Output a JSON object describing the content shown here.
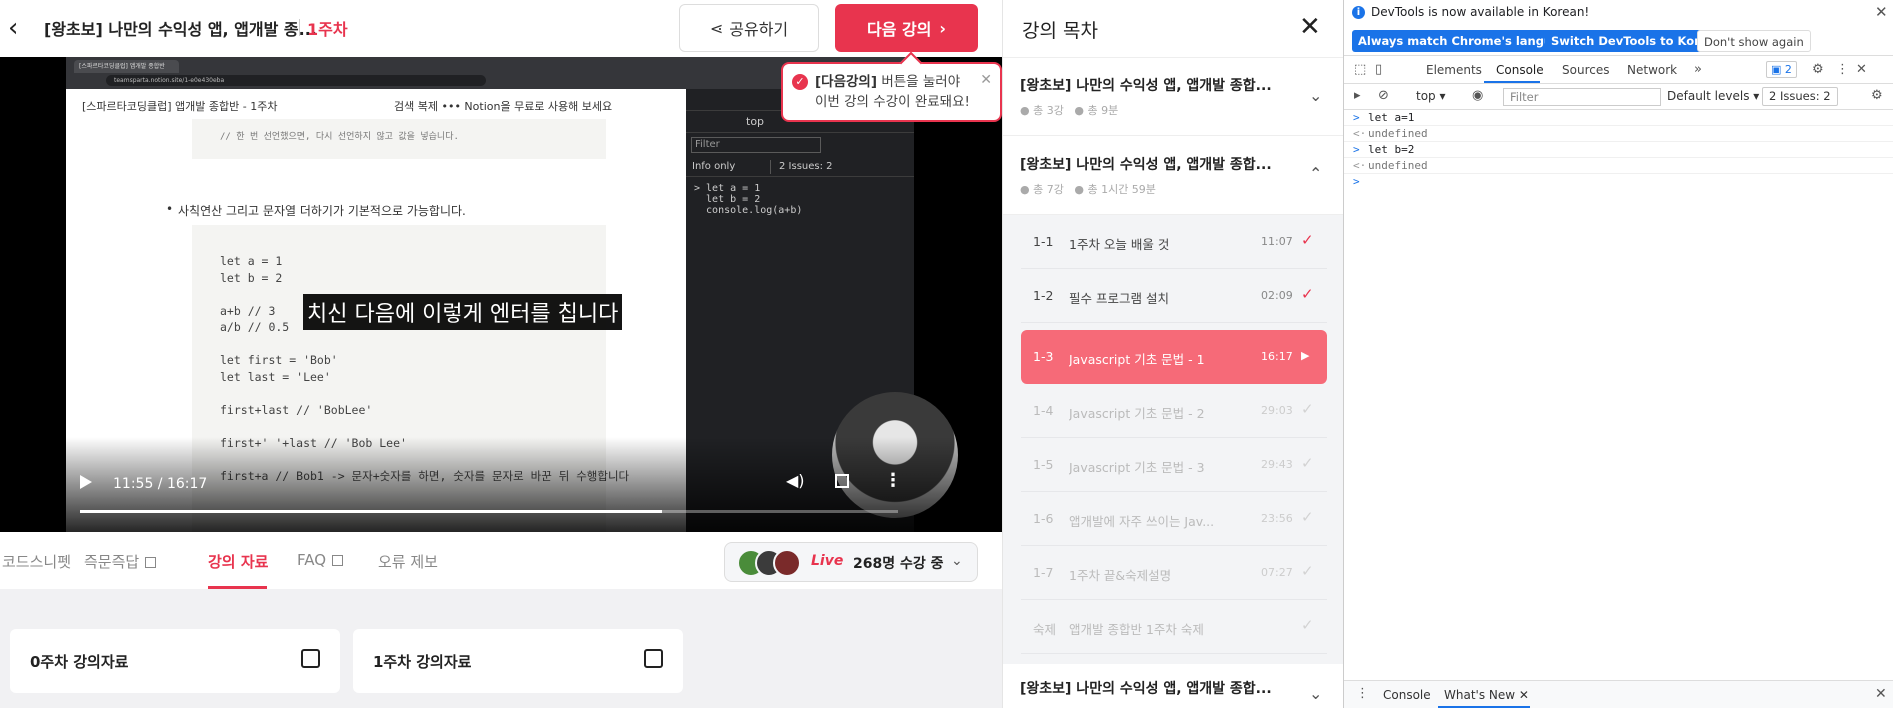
{
  "header": {
    "course_title": "[왕초보] 나만의 수익성 앱, 앱개발 종...",
    "week": "1주차",
    "share_label": "공유하기",
    "next_label": "다음 강의"
  },
  "tooltip": {
    "bold": "[다음강의]",
    "line1": " 버튼을 눌러야",
    "line2": "이번 강의 수강이 완료돼요!"
  },
  "video": {
    "browser_tab": "[스파르타코딩클럽] 앱개발 종합반",
    "url": "teamsparta.notion.site/1-e0e430eba",
    "notion_title": "[스파르타코딩클럽] 앱개발 종합반 - 1주차",
    "notion_right": "검색   복제   •••    Notion을 무료로 사용해 보세요",
    "code_top": "// 한 번 선언했으면, 다시 선언하지 않고 값을 넣습니다.",
    "bullet": "사칙연산 그리고 문자열 더하기가 기본적으로 가능합니다.",
    "code_main": "let a = 1\nlet b = 2\n\na+b // 3\na/b // 0.5\n\nlet first = 'Bob'\nlet last = 'Lee'\n\nfirst+last // 'BobLee'\n\nfirst+' '+last // 'Bob Lee'\n\nfirst+a // Bob1 -> 문자+숫자를 하면, 숫자를 문자로 바꾼 뒤 수행합니다",
    "dm_top": "top",
    "dm_filter": "Filter",
    "dm_info": "Info only",
    "dm_issues": "2 Issues: 2",
    "dm_code": "> let a = 1\n  let b = 2\n  console.log(a+b)",
    "subtitle": "치신 다음에 이렇게 엔터를 칩니다",
    "time": "11:55 / 16:17",
    "progress": 0.712
  },
  "tabs": [
    {
      "label": "코드스니펫"
    },
    {
      "label": "즉문즉답"
    },
    {
      "label": "강의 자료"
    },
    {
      "label": "FAQ"
    },
    {
      "label": "오류 제보"
    }
  ],
  "live": {
    "label": "Live",
    "viewers": "268명 수강 중"
  },
  "cards": [
    {
      "label": "0주차 강의자료"
    },
    {
      "label": "1주차 강의자료"
    }
  ],
  "outline": {
    "title": "강의 목차",
    "sections": [
      {
        "title": "[왕초보] 나만의 수익성 앱, 앱개발 종합...",
        "count": "총 3강",
        "duration": "총 9분"
      },
      {
        "title": "[왕초보] 나만의 수익성 앱, 앱개발 종합...",
        "count": "총 7강",
        "duration": "총 1시간 59분"
      },
      {
        "title": "[왕초보] 나만의 수익성 앱, 앱개발 종합..."
      }
    ],
    "lessons": [
      {
        "num": "1-1",
        "title": "1주차 오늘 배울 것",
        "duration": "11:07"
      },
      {
        "num": "1-2",
        "title": "필수 프로그램 설치",
        "duration": "02:09"
      },
      {
        "num": "1-3",
        "title": "Javascript 기초 문법 - 1",
        "duration": "16:17"
      },
      {
        "num": "1-4",
        "title": "Javascript 기초 문법 - 2",
        "duration": "29:03"
      },
      {
        "num": "1-5",
        "title": "Javascript 기초 문법 - 3",
        "duration": "29:43"
      },
      {
        "num": "1-6",
        "title": "앱개발에 자주 쓰이는 Jav...",
        "duration": "23:56"
      },
      {
        "num": "1-7",
        "title": "1주차 끝&숙제설명",
        "duration": "07:27"
      },
      {
        "num": "숙제",
        "title": "앱개발 종합반 1주차 숙제",
        "duration": ""
      }
    ]
  },
  "devtools": {
    "info": "DevTools is now available in Korean!",
    "btn_match": "Always match Chrome's language",
    "btn_switch": "Switch DevTools to Korean",
    "btn_dont": "Don't show again",
    "tabs": [
      "Elements",
      "Console",
      "Sources",
      "Network"
    ],
    "issues_badge": "2",
    "context": "top",
    "filter_placeholder": "Filter",
    "levels": "Default levels",
    "issues": "2 Issues:  2",
    "console_lines": [
      {
        "prefix": ">",
        "text": "let a=1"
      },
      {
        "prefix": "<·",
        "text": "undefined"
      },
      {
        "prefix": ">",
        "text": "let b=2"
      },
      {
        "prefix": "<·",
        "text": "undefined"
      },
      {
        "prefix": ">",
        "text": ""
      }
    ],
    "bottom_tabs": [
      "Console",
      "What's New"
    ]
  }
}
